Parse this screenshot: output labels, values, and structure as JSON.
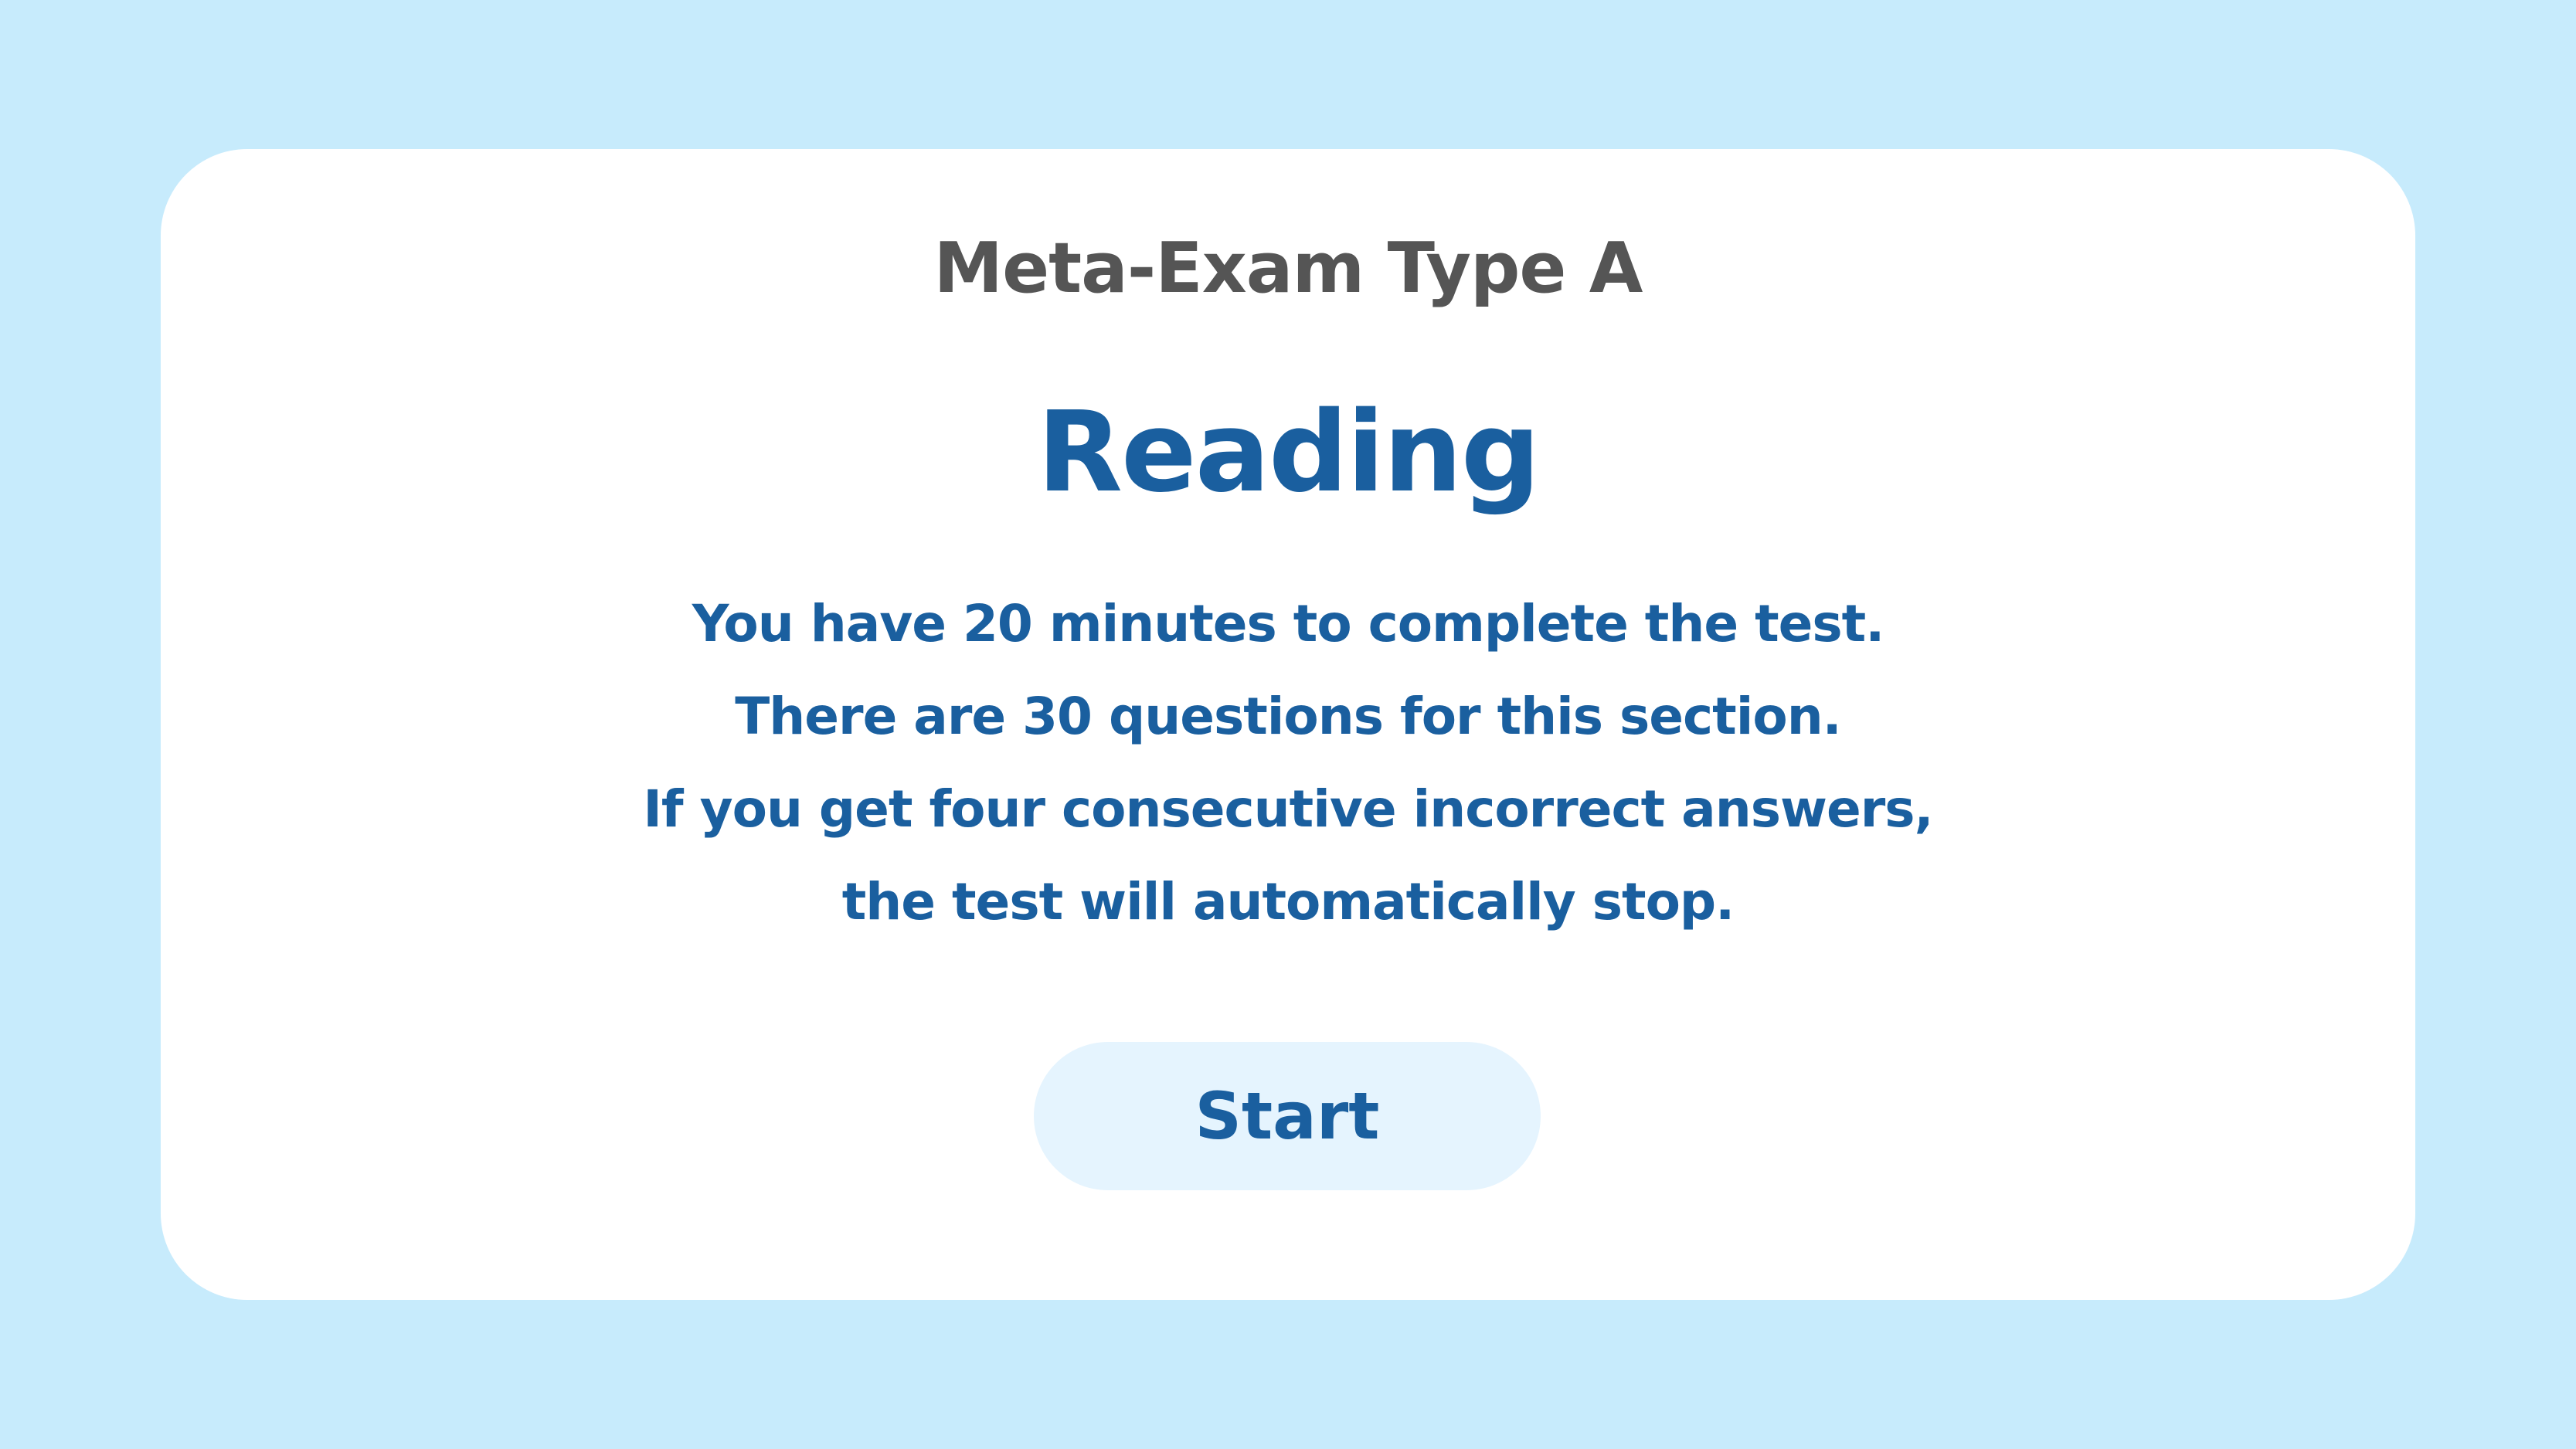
{
  "exam": {
    "type_label": "Meta-Exam Type A",
    "section_title": "Reading"
  },
  "instructions": [
    "You have 20 minutes to complete the test.",
    "There are 30 questions for this section.",
    "If you get four consecutive incorrect answers,",
    "the test will automatically stop."
  ],
  "actions": {
    "start_label": "Start"
  },
  "colors": {
    "background": "#c7ebfc",
    "card": "#ffffff",
    "accent_text": "#1a5f9f",
    "secondary_text": "#555555",
    "button_background": "#e5f4fe"
  }
}
